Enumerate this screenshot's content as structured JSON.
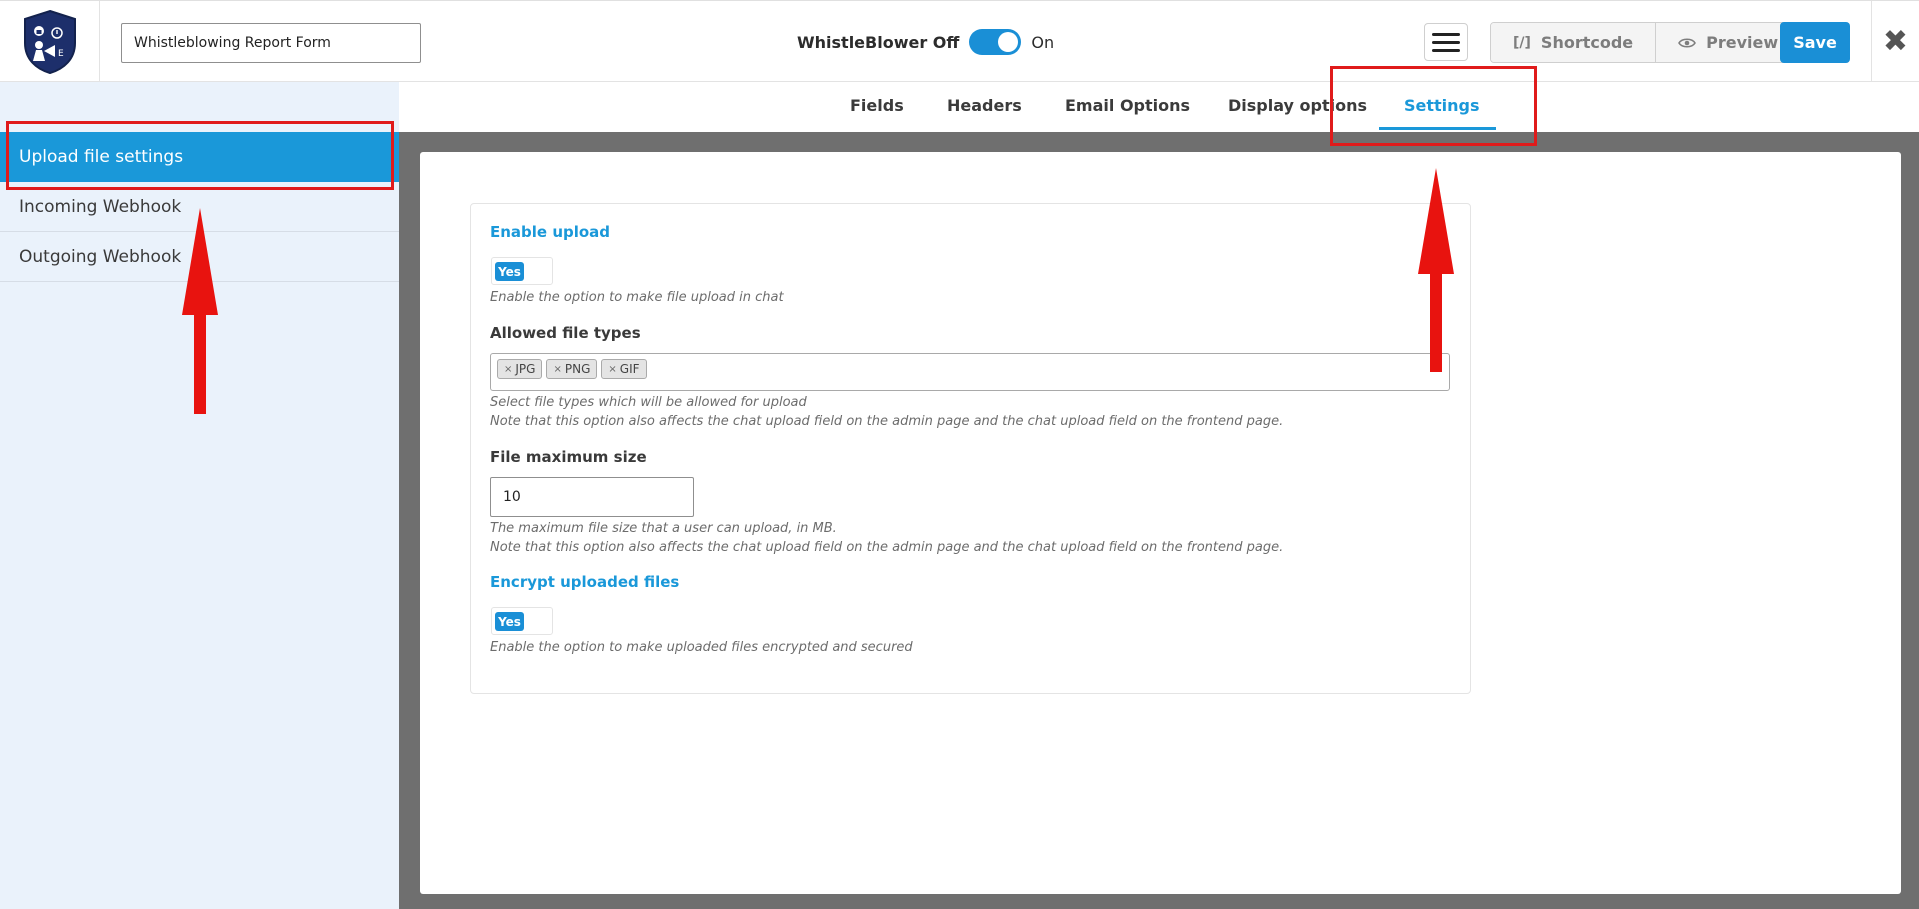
{
  "topbar": {
    "form_title_value": "Whistleblowing Report Form",
    "toggle_off_label": "WhistleBlower Off",
    "toggle_on_label": "On",
    "shortcode_label": "Shortcode",
    "shortcode_icon_text": "[/]",
    "preview_label": "Preview",
    "save_label": "Save",
    "close_glyph": "✖"
  },
  "sidebar": {
    "items": [
      {
        "label": "Upload file settings",
        "active": true
      },
      {
        "label": "Incoming Webhook",
        "active": false
      },
      {
        "label": "Outgoing Webhook",
        "active": false
      }
    ]
  },
  "tabs": [
    {
      "label": "Fields"
    },
    {
      "label": "Headers"
    },
    {
      "label": "Email Options"
    },
    {
      "label": "Display options"
    },
    {
      "label": "Settings",
      "active": true
    }
  ],
  "settings": {
    "enable_upload": {
      "title": "Enable upload",
      "toggle_label": "Yes",
      "help": "Enable the option to make file upload in chat"
    },
    "allowed_types": {
      "title": "Allowed file types",
      "tags": [
        "JPG",
        "PNG",
        "GIF"
      ],
      "tag_remove_glyph": "×",
      "help1": "Select file types which will be allowed for upload",
      "help2": "Note that this option also affects the chat upload field on the admin page and the chat upload field on the frontend page."
    },
    "max_size": {
      "title": "File maximum size",
      "value": "10",
      "help1": "The maximum file size that a user can upload, in MB.",
      "help2": "Note that this option also affects the chat upload field on the admin page and the chat upload field on the frontend page."
    },
    "encrypt": {
      "title": "Encrypt uploaded files",
      "toggle_label": "Yes",
      "help": "Enable the option to make uploaded files encrypted and secured"
    }
  },
  "colors": {
    "accent": "#1a98d9",
    "annotation": "#e01b1b",
    "sidebar_bg": "#eaf2fb",
    "content_bg": "#6f6f6f"
  }
}
